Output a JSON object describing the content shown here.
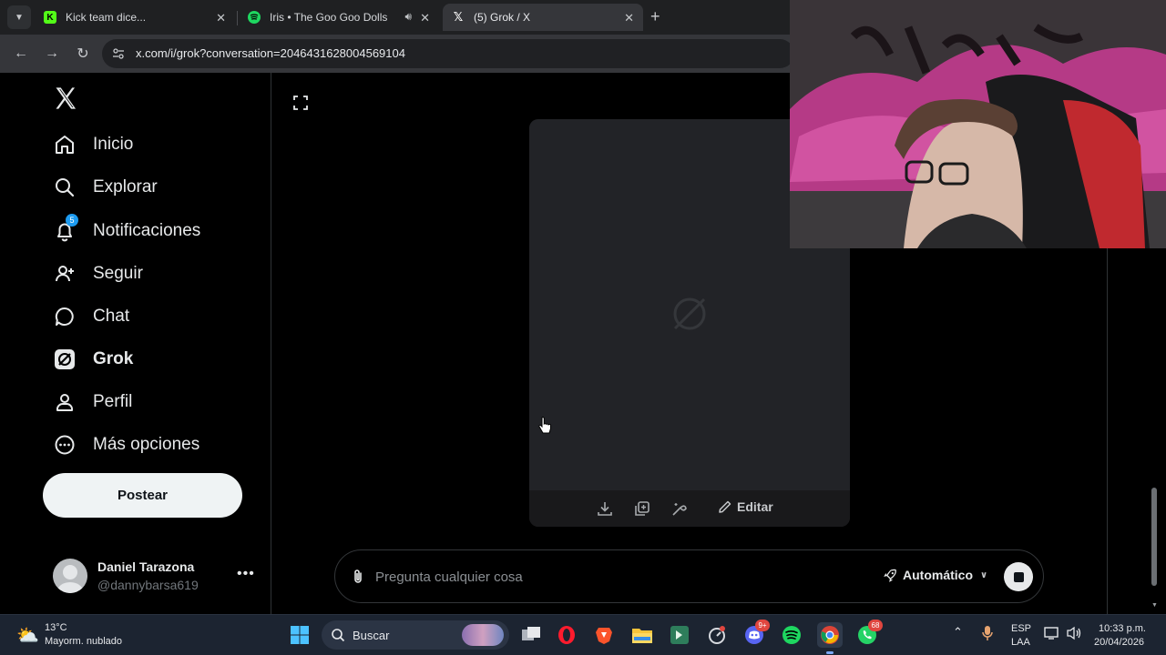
{
  "browser": {
    "tabs": [
      {
        "title": "Kick team dice...",
        "favicon": "kick-icon",
        "color": "#53fc18"
      },
      {
        "title": "Iris • The Goo Goo Dolls",
        "favicon": "spotify-icon",
        "color": "#1ed760",
        "audio": true
      },
      {
        "title": "(5) Grok / X",
        "favicon": "x-icon",
        "active": true
      }
    ],
    "url": "x.com/i/grok?conversation=2046431628004569104"
  },
  "sidebar": {
    "items": [
      {
        "label": "Inicio",
        "icon": "home-icon"
      },
      {
        "label": "Explorar",
        "icon": "search-icon"
      },
      {
        "label": "Notificaciones",
        "icon": "bell-icon",
        "badge": "5"
      },
      {
        "label": "Seguir",
        "icon": "follow-icon"
      },
      {
        "label": "Chat",
        "icon": "chat-icon"
      },
      {
        "label": "Grok",
        "icon": "grok-icon",
        "active": true
      },
      {
        "label": "Perfil",
        "icon": "profile-icon"
      },
      {
        "label": "Más opciones",
        "icon": "more-options-icon"
      }
    ],
    "post_label": "Postear",
    "account": {
      "name": "Daniel Tarazona",
      "handle": "@dannybarsa619"
    }
  },
  "grok": {
    "card_actions": {
      "edit_label": "Editar"
    },
    "composer": {
      "placeholder": "Pregunta cualquier cosa",
      "mode_label": "Automático"
    }
  },
  "taskbar": {
    "weather": {
      "temp": "13°C",
      "desc": "Mayorm. nublado"
    },
    "search_label": "Buscar",
    "discord_badge": "9+",
    "whatsapp_badge": "68",
    "language": {
      "line1": "ESP",
      "line2": "LAA"
    },
    "clock": {
      "time": "10:33 p.m.",
      "date": "20/04/2026"
    }
  },
  "colors": {
    "accent": "#1d9bf0",
    "background": "#000000",
    "card": "#222327"
  }
}
